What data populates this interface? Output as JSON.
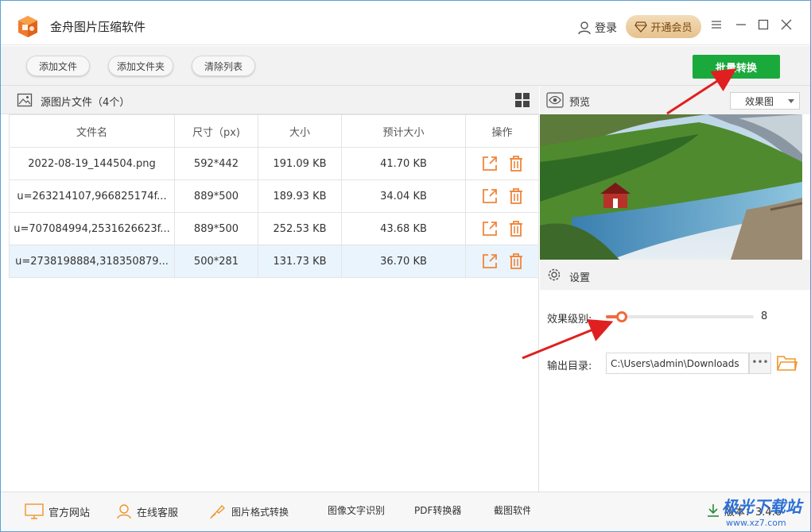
{
  "window": {
    "title": "金舟图片压缩软件",
    "login_label": "登录",
    "vip_label": "开通会员"
  },
  "toolbar": {
    "add_file": "添加文件",
    "add_folder": "添加文件夹",
    "clear_list": "清除列表",
    "batch_convert": "批量转换"
  },
  "source": {
    "title": "源图片文件（4个）",
    "columns": [
      "文件名",
      "尺寸（px)",
      "大小",
      "预计大小",
      "操作"
    ],
    "rows": [
      {
        "name": "2022-08-19_144504.png",
        "size_px": "592*442",
        "size": "191.09 KB",
        "estimated": "41.70 KB"
      },
      {
        "name": "u=263214107,966825174f...",
        "size_px": "889*500",
        "size": "189.93 KB",
        "estimated": "34.04 KB"
      },
      {
        "name": "u=707084994,2531626623f...",
        "size_px": "889*500",
        "size": "252.53 KB",
        "estimated": "43.68 KB"
      },
      {
        "name": "u=2738198884,318350879...",
        "size_px": "500*281",
        "size": "131.73 KB",
        "estimated": "36.70 KB"
      }
    ],
    "selected_row": 3
  },
  "preview": {
    "title": "预览",
    "mode": "效果图"
  },
  "settings": {
    "title": "设置",
    "effect_label": "效果级别:",
    "effect_value": "8",
    "effect_level": 0.08,
    "output_label": "输出目录:",
    "output_path": "C:\\Users\\admin\\Downloads",
    "more_label": "•••"
  },
  "footer": {
    "items": [
      "官方网站",
      "在线客服",
      "图片格式转换",
      "图像文字识别",
      "PDF转换器",
      "截图软件"
    ],
    "version": "版本：3.4.6"
  },
  "watermark": {
    "site": "极光下载站",
    "url": "www.xz7.com"
  },
  "colors": {
    "accent_orange": "#f06a3c",
    "batch_green": "#1aaa3c",
    "selected_row": "#eaf4fc",
    "arrow_red": "#e02020"
  }
}
